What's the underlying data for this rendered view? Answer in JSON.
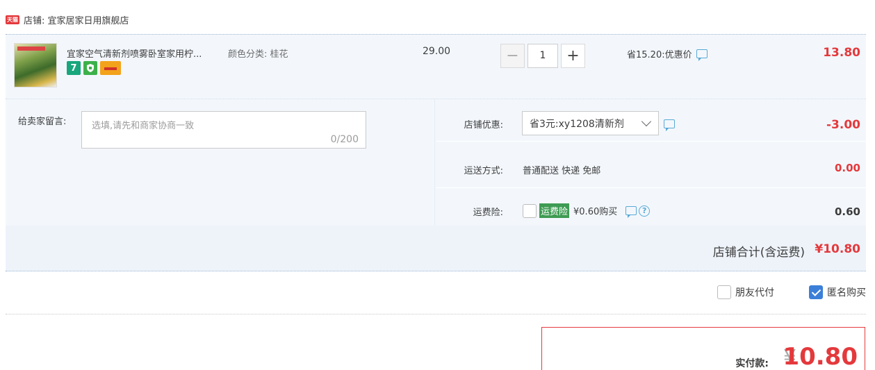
{
  "shop": {
    "logo_text": "天猫",
    "label": "店铺: 宜家居家日用旗舰店"
  },
  "product": {
    "title": "宜家空气清新剂喷雾卧室家用柠...",
    "sku": "颜色分类: 桂花",
    "unit_price": "29.00",
    "quantity": "1",
    "promo": "省15.20:优惠价",
    "total": "13.80",
    "badges": [
      "7",
      "shield",
      "card"
    ]
  },
  "memo": {
    "label": "给卖家留言:",
    "placeholder": "选填,请先和商家协商一致",
    "count": "0/200"
  },
  "discount": {
    "label": "店铺优惠:",
    "selected": "省3元:xy1208清新剂",
    "amount": "-3.00"
  },
  "shipping": {
    "label": "运送方式:",
    "value": "普通配送 快递 免邮",
    "amount": "0.00"
  },
  "insurance": {
    "label": "运费险:",
    "badge": "运费险",
    "value": "¥0.60购买",
    "amount": "0.60"
  },
  "shop_total": {
    "label": "店铺合计(含运费)",
    "amount": "¥10.80"
  },
  "checkout": {
    "friend_pay": "朋友代付",
    "anonymous": "匿名购买",
    "anonymous_checked": true
  },
  "payment": {
    "label": "实付款:",
    "currency": "¥",
    "amount": "10.80"
  },
  "colors": {
    "accent_red": "#e4393c",
    "link_blue": "#58a9d6",
    "row_bg": "#f3f7fc"
  }
}
